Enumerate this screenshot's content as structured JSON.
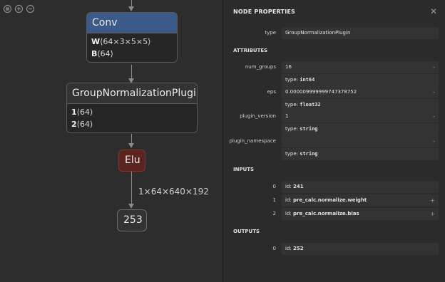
{
  "graph": {
    "toolbar": [
      {
        "icon": "list-icon"
      },
      {
        "icon": "zoom-in-icon"
      },
      {
        "icon": "zoom-out-icon"
      }
    ],
    "nodes": {
      "conv": {
        "title": "Conv",
        "inputs": [
          {
            "name": "W",
            "shape": "⟨64×3×5×5⟩"
          },
          {
            "name": "B",
            "shape": "⟨64⟩"
          }
        ]
      },
      "gnp": {
        "title": "GroupNormalizationPlugin",
        "inputs": [
          {
            "name": "1",
            "shape": "⟨64⟩"
          },
          {
            "name": "2",
            "shape": "⟨64⟩"
          }
        ]
      },
      "elu": {
        "title": "Elu"
      },
      "output": {
        "title": "253"
      }
    },
    "edge_label": "1×64×640×192",
    "colors": {
      "conv_header": "#3b5a8a",
      "elu": "#5a2420"
    }
  },
  "panel": {
    "title": "NODE PROPERTIES",
    "close_icon": "close-icon",
    "type_label": "type",
    "type_value": "GroupNormalizationPlugin",
    "attributes_title": "ATTRIBUTES",
    "attributes": [
      {
        "name": "num_groups",
        "value": "16",
        "type_prefix": "type: ",
        "type": "int64"
      },
      {
        "name": "eps",
        "value": "0.00000999999974737875​2",
        "type_prefix": "type: ",
        "type": "float32"
      },
      {
        "name": "plugin_version",
        "value": "1",
        "type_prefix": "type: ",
        "type": "string"
      },
      {
        "name": "plugin_namespace",
        "value": "",
        "type_prefix": "type: ",
        "type": "string"
      }
    ],
    "inputs_title": "INPUTS",
    "inputs": [
      {
        "index": "0",
        "id_prefix": "id: ",
        "id": "241"
      },
      {
        "index": "1",
        "id_prefix": "id: ",
        "id": "pre_calc.normalize.weight"
      },
      {
        "index": "2",
        "id_prefix": "id: ",
        "id": "pre_calc.normalize.bias"
      }
    ],
    "outputs_title": "OUTPUTS",
    "outputs": [
      {
        "index": "0",
        "id_prefix": "id: ",
        "id": "252"
      }
    ]
  }
}
